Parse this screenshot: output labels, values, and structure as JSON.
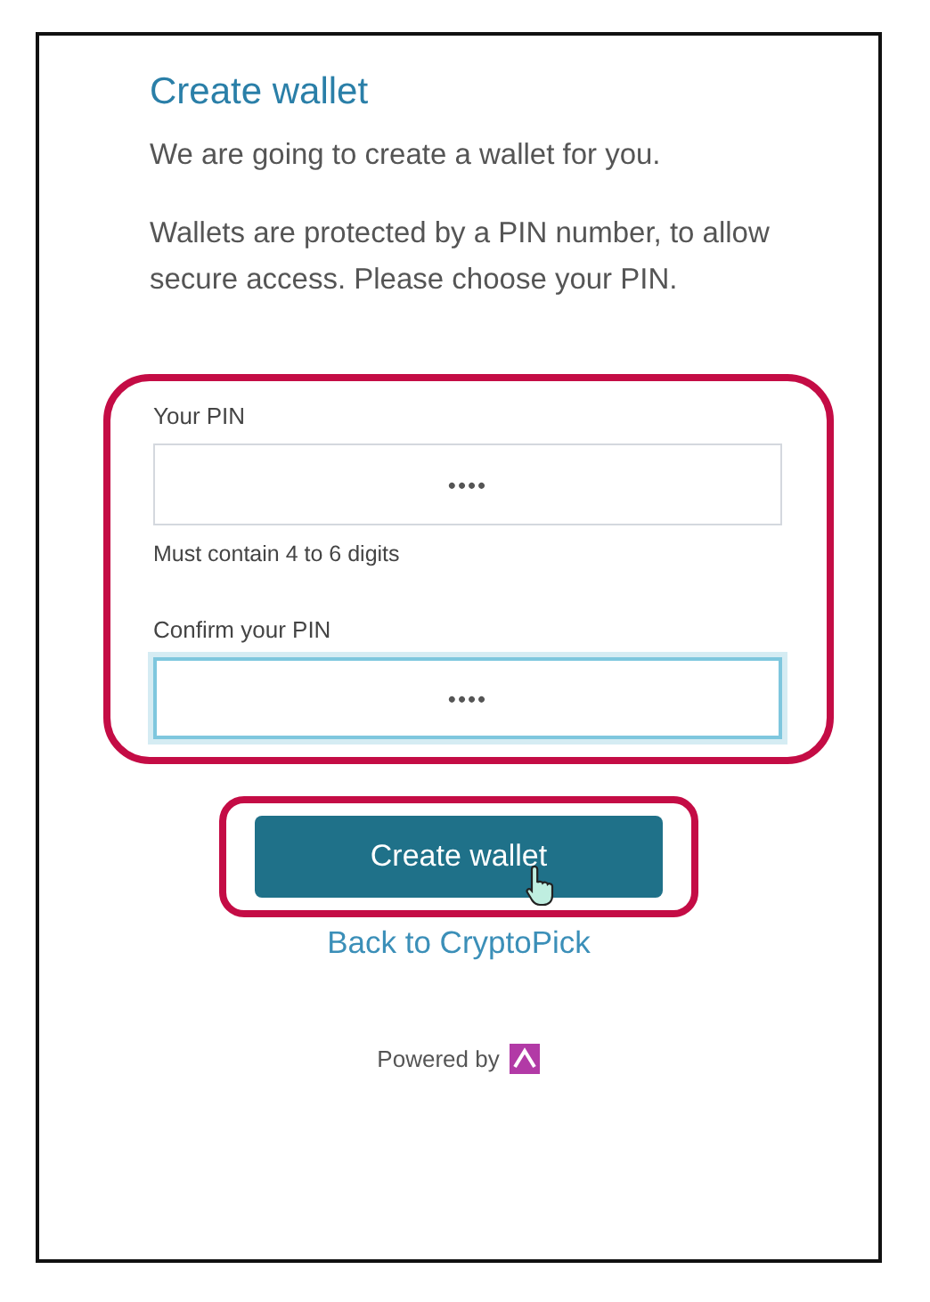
{
  "title": "Create wallet",
  "intro": "We are going to create a wallet for you.",
  "description": "Wallets are protected by a PIN number, to allow secure access. Please choose your PIN.",
  "fields": [
    {
      "label": "Your PIN",
      "value": "••••",
      "hint": "Must contain 4 to 6 digits",
      "focused": false
    },
    {
      "label": "Confirm your PIN",
      "value": "••••",
      "focused": true
    }
  ],
  "highlighted": true,
  "button": {
    "label": "Create wallet",
    "highlighted": true
  },
  "back_link": "Back to CryptoPick",
  "footer": {
    "text": "Powered by"
  }
}
